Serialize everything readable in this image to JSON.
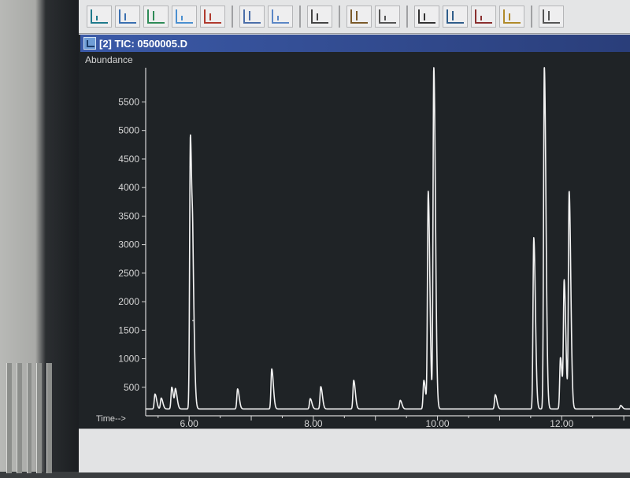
{
  "window": {
    "title": "[2] TIC: 0500005.D"
  },
  "toolbar": {
    "icons": [
      "chromatogram-icon",
      "integrate-icon",
      "peak-list-icon",
      "spectrum-icon",
      "report-icon",
      "baseline-icon",
      "peak-select-icon",
      "tabulate-icon",
      "library-icon",
      "library-search-icon",
      "axis-icon",
      "calibrate-icon",
      "edit-calibration-icon",
      "quantitate-icon",
      "print-icon"
    ]
  },
  "chart_data": {
    "type": "line",
    "ylabel": "Abundance",
    "xlabel": "Time-->",
    "xlim": [
      5.3,
      13.1
    ],
    "ylim": [
      0,
      6100
    ],
    "y_ticks": [
      500,
      1000,
      1500,
      2000,
      2500,
      3000,
      3500,
      4000,
      4500,
      5000,
      5500
    ],
    "y_tick_labels": [
      "500",
      "1000",
      "1500",
      "2000",
      "2500",
      "3000",
      "3500",
      "4000",
      "4500",
      "5000",
      "5500"
    ],
    "x_ticks": [
      6.0,
      8.0,
      10.0,
      12.0
    ],
    "x_tick_labels": [
      "6.00",
      "8.00",
      "10.00",
      "12.00"
    ],
    "grid": false,
    "colors": {
      "background": "#1f2326",
      "trace": "#f2f2f2",
      "axis": "#d6d6d6"
    },
    "baseline": 120,
    "series": [
      {
        "peaks": [
          {
            "rt": 5.45,
            "height": 260
          },
          {
            "rt": 5.55,
            "height": 190
          },
          {
            "rt": 5.72,
            "height": 380
          },
          {
            "rt": 5.78,
            "height": 330
          },
          {
            "rt": 6.02,
            "height": 4800
          },
          {
            "rt": 6.06,
            "height": 1550
          },
          {
            "rt": 6.78,
            "height": 350
          },
          {
            "rt": 7.33,
            "height": 700
          },
          {
            "rt": 7.95,
            "height": 180
          },
          {
            "rt": 8.12,
            "height": 390
          },
          {
            "rt": 8.65,
            "height": 500
          },
          {
            "rt": 9.4,
            "height": 150
          },
          {
            "rt": 9.78,
            "height": 500
          },
          {
            "rt": 9.85,
            "height": 3800
          },
          {
            "rt": 9.94,
            "height": 6000
          },
          {
            "rt": 10.93,
            "height": 250
          },
          {
            "rt": 11.55,
            "height": 3000
          },
          {
            "rt": 11.72,
            "height": 6000
          },
          {
            "rt": 11.98,
            "height": 900
          },
          {
            "rt": 12.04,
            "height": 2200
          },
          {
            "rt": 12.12,
            "height": 3800
          },
          {
            "rt": 12.95,
            "height": 60
          }
        ]
      }
    ]
  }
}
